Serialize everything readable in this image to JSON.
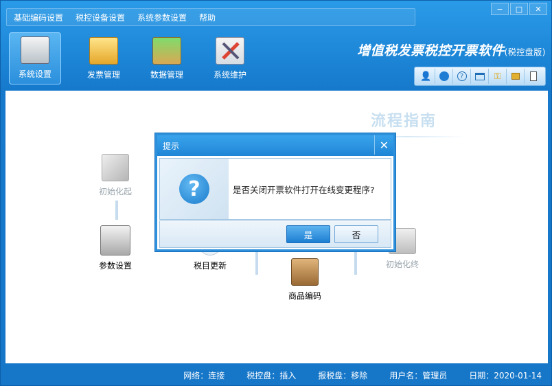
{
  "menu": [
    "基础编码设置",
    "税控设备设置",
    "系统参数设置",
    "帮助"
  ],
  "window_controls": [
    "−",
    "□",
    "✕"
  ],
  "toolbar": [
    {
      "label": "系统设置",
      "icon": "settings-icon",
      "active": true
    },
    {
      "label": "发票管理",
      "icon": "invoice-folder-icon",
      "active": false
    },
    {
      "label": "数据管理",
      "icon": "data-box-icon",
      "active": false
    },
    {
      "label": "系统维护",
      "icon": "maintenance-tools-icon",
      "active": false
    }
  ],
  "brand": {
    "title": "增值税发票税控开票软件",
    "subtitle": "(税控盘版)"
  },
  "iconbar": [
    "user-icon",
    "globe-icon",
    "help-icon",
    "window-icon",
    "key-icon",
    "lock-icon",
    "document-icon"
  ],
  "guide": {
    "title": "流程指南"
  },
  "flow": {
    "init_start": "初始化起",
    "params": "参数设置",
    "tax_update": "税目更新",
    "goods_code": "商品编码",
    "init_end": "初始化终"
  },
  "dialog": {
    "title": "提示",
    "message": "是否关闭开票软件打开在线变更程序?",
    "yes": "是",
    "no": "否"
  },
  "status": {
    "network": "网络：连接",
    "tax_disk": "税控盘：插入",
    "report_disk": "报税盘：移除",
    "user": "用户名：管理员",
    "date": "日期：2020-01-14"
  }
}
